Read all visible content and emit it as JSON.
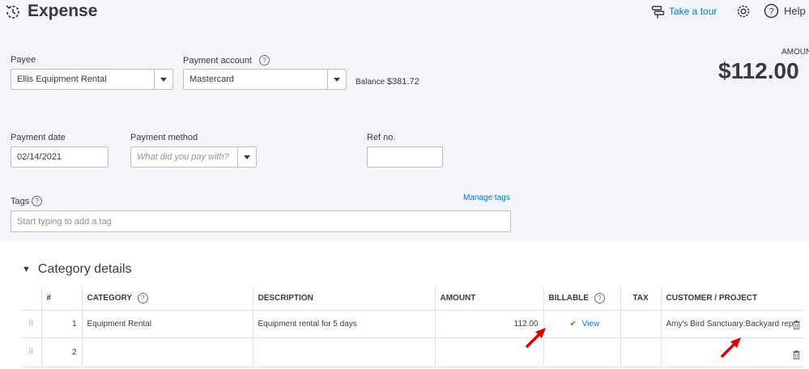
{
  "header": {
    "title": "Expense",
    "take_tour": "Take a tour",
    "help": "Help"
  },
  "amount": {
    "label": "AMOUNT",
    "value": "$112.00"
  },
  "form": {
    "payee_label": "Payee",
    "payee_value": "Ellis Equipment Rental",
    "payment_account_label": "Payment account",
    "payment_account_value": "Mastercard",
    "balance_label": "Balance",
    "balance_value": "$381.72",
    "payment_date_label": "Payment date",
    "payment_date_value": "02/14/2021",
    "payment_method_label": "Payment method",
    "payment_method_placeholder": "What did you pay with?",
    "ref_no_label": "Ref no.",
    "ref_no_value": "",
    "tags_label": "Tags",
    "manage_tags": "Manage tags",
    "tags_placeholder": "Start typing to add a tag"
  },
  "category": {
    "section_title": "Category details",
    "headers": {
      "num": "#",
      "category": "CATEGORY",
      "description": "DESCRIPTION",
      "amount": "AMOUNT",
      "billable": "BILLABLE",
      "tax": "TAX",
      "customer": "CUSTOMER / PROJECT"
    },
    "rows": [
      {
        "num": "1",
        "category": "Equipment Rental",
        "description": "Equipment rental for 5 days",
        "amount": "112.00",
        "billable_check": "✔",
        "billable_link": "View",
        "tax": "",
        "customer": "Amy's Bird Sanctuary:Backyard rep"
      },
      {
        "num": "2",
        "category": "",
        "description": "",
        "amount": "",
        "billable_check": "",
        "billable_link": "",
        "tax": "",
        "customer": ""
      }
    ]
  },
  "icons": {
    "history": "history-icon",
    "tour": "tour-signpost-icon",
    "settings": "gear-icon",
    "help": "help-circle-icon",
    "drag": "drag-handle-icon",
    "delete": "trash-icon",
    "annotation": "red-arrow-icon"
  },
  "colors": {
    "link": "#0077c5",
    "check": "#2ca01c",
    "annotation_arrow": "#e00000",
    "header_bg": "#f4f5f8"
  }
}
